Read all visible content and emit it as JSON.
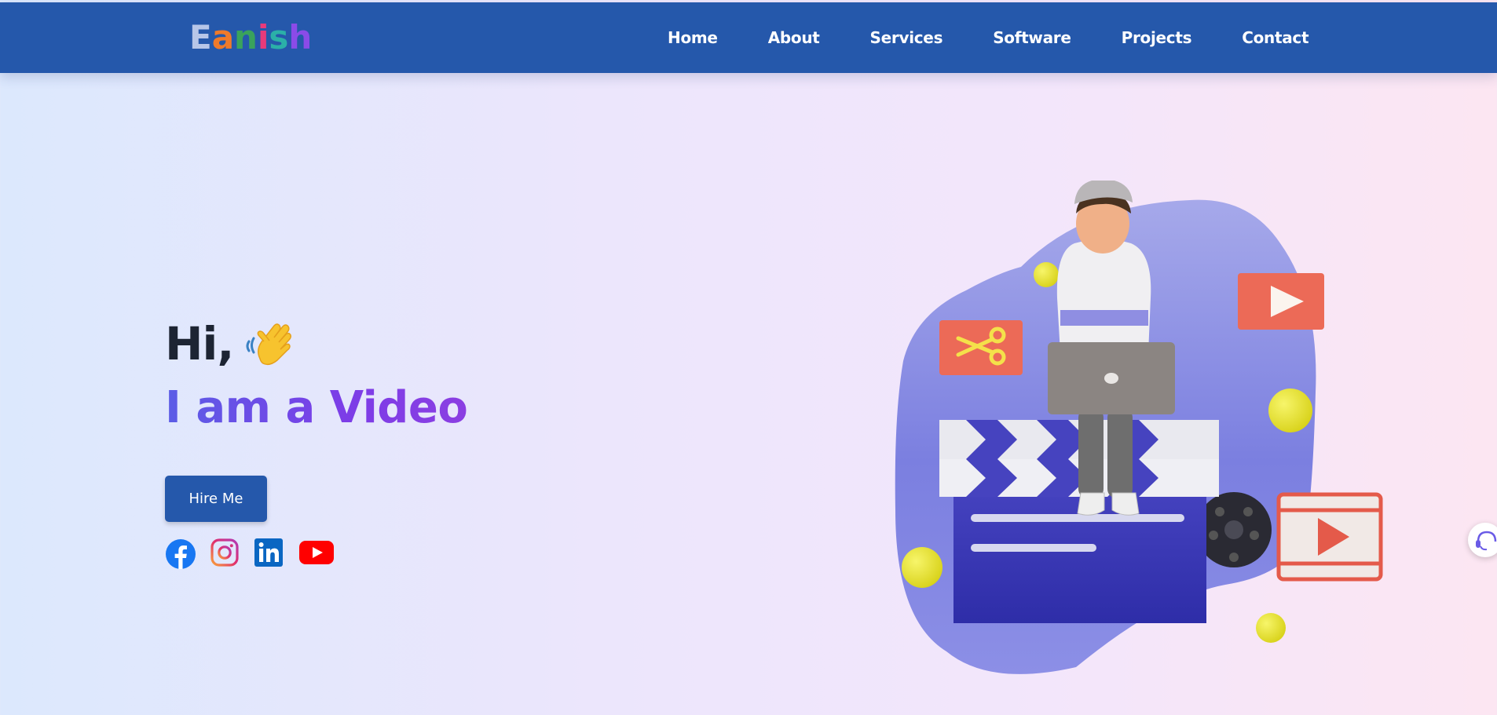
{
  "brand": {
    "letters": [
      {
        "ch": "E",
        "color": "#b7c6e8"
      },
      {
        "ch": "a",
        "color": "#f07a2a"
      },
      {
        "ch": "n",
        "color": "#3aa35c"
      },
      {
        "ch": "i",
        "color": "#e83a7a"
      },
      {
        "ch": "s",
        "color": "#2bb0a8"
      },
      {
        "ch": "h",
        "color": "#8b4be8"
      }
    ]
  },
  "nav": {
    "items": [
      "Home",
      "About",
      "Services",
      "Software",
      "Projects",
      "Contact"
    ]
  },
  "hero": {
    "greeting": "Hi,",
    "title": "I am a Video",
    "hire_label": "Hire Me"
  },
  "socials": [
    "facebook-icon",
    "instagram-icon",
    "linkedin-icon",
    "youtube-icon"
  ],
  "colors": {
    "nav_bg": "#2558ab",
    "accent_start": "#5b5de6",
    "accent_end": "#8b3ee2",
    "button_bg": "#2558ab"
  }
}
